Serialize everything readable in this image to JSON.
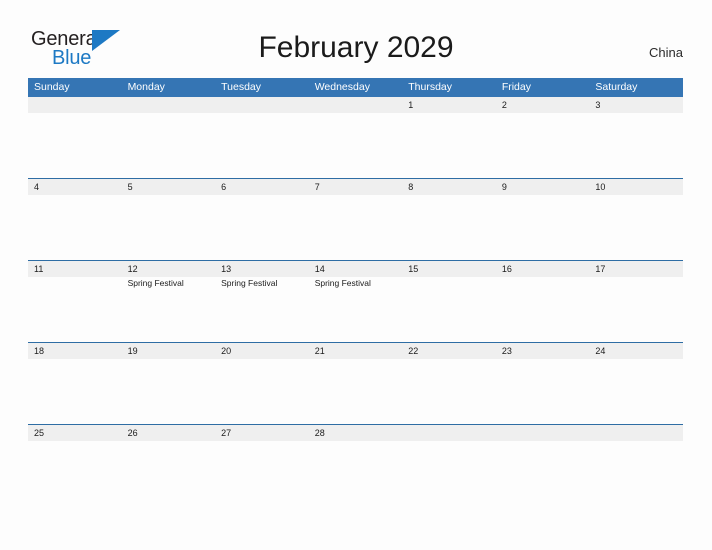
{
  "brand": {
    "word_one": "General",
    "word_two": "Blue",
    "flag_icon": "blue-triangle-flag",
    "color_dark": "#231f20",
    "color_blue": "#1d79c4"
  },
  "header": {
    "title": "February 2029",
    "region": "China"
  },
  "theme": {
    "header_blue": "#3575b4",
    "row_divider_blue": "#2e6da4",
    "band_gray": "#efefef",
    "page_background": "#fdfdfd",
    "text_dark": "#1b1b1b"
  },
  "calendar": {
    "weekdays": [
      "Sunday",
      "Monday",
      "Tuesday",
      "Wednesday",
      "Thursday",
      "Friday",
      "Saturday"
    ],
    "weeks": [
      [
        {
          "date": "",
          "events": []
        },
        {
          "date": "",
          "events": []
        },
        {
          "date": "",
          "events": []
        },
        {
          "date": "",
          "events": []
        },
        {
          "date": "1",
          "events": []
        },
        {
          "date": "2",
          "events": []
        },
        {
          "date": "3",
          "events": []
        }
      ],
      [
        {
          "date": "4",
          "events": []
        },
        {
          "date": "5",
          "events": []
        },
        {
          "date": "6",
          "events": []
        },
        {
          "date": "7",
          "events": []
        },
        {
          "date": "8",
          "events": []
        },
        {
          "date": "9",
          "events": []
        },
        {
          "date": "10",
          "events": []
        }
      ],
      [
        {
          "date": "11",
          "events": []
        },
        {
          "date": "12",
          "events": [
            "Spring Festival"
          ]
        },
        {
          "date": "13",
          "events": [
            "Spring Festival"
          ]
        },
        {
          "date": "14",
          "events": [
            "Spring Festival"
          ]
        },
        {
          "date": "15",
          "events": []
        },
        {
          "date": "16",
          "events": []
        },
        {
          "date": "17",
          "events": []
        }
      ],
      [
        {
          "date": "18",
          "events": []
        },
        {
          "date": "19",
          "events": []
        },
        {
          "date": "20",
          "events": []
        },
        {
          "date": "21",
          "events": []
        },
        {
          "date": "22",
          "events": []
        },
        {
          "date": "23",
          "events": []
        },
        {
          "date": "24",
          "events": []
        }
      ],
      [
        {
          "date": "25",
          "events": []
        },
        {
          "date": "26",
          "events": []
        },
        {
          "date": "27",
          "events": []
        },
        {
          "date": "28",
          "events": []
        },
        {
          "date": "",
          "events": []
        },
        {
          "date": "",
          "events": []
        },
        {
          "date": "",
          "events": []
        }
      ]
    ]
  }
}
